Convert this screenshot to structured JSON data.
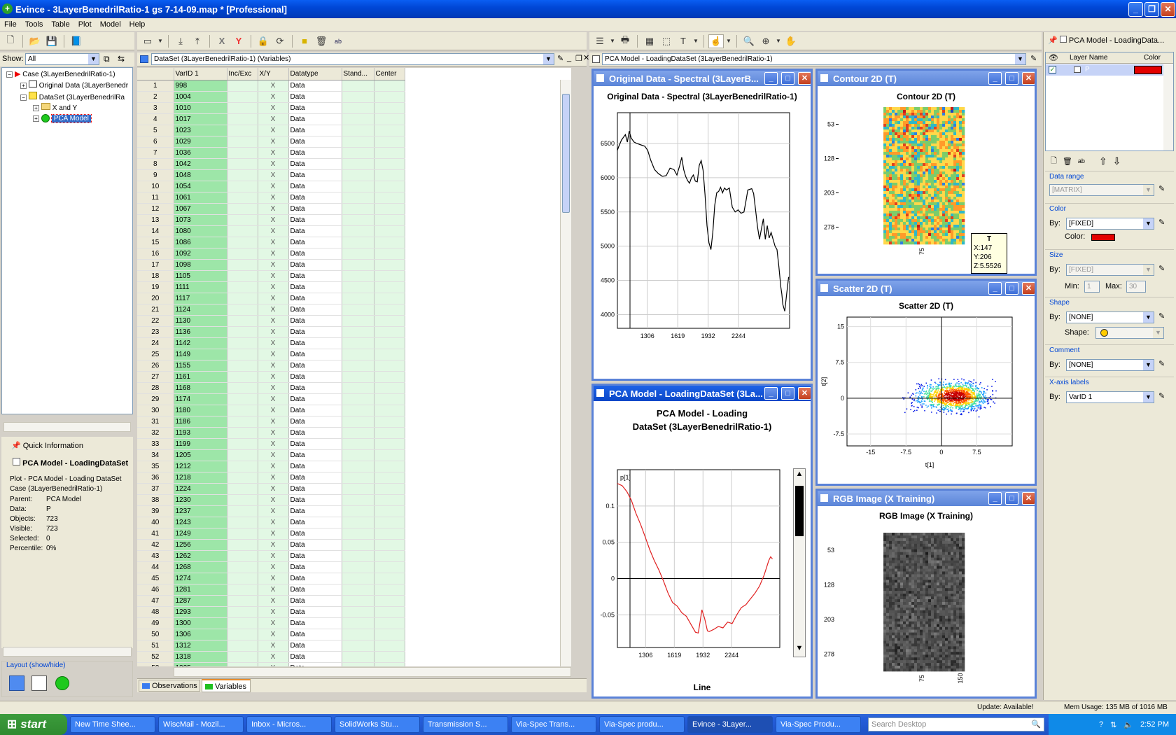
{
  "window": {
    "title": "Evince - 3LayerBenedrilRatio-1 gs 7-14-09.map * [Professional]"
  },
  "menu": [
    "File",
    "Tools",
    "Table",
    "Plot",
    "Model",
    "Help"
  ],
  "left": {
    "show_label": "Show:",
    "show_value": "All",
    "tree": [
      {
        "label": "Case (3LayerBenedrilRatio-1)",
        "icon": "red-triangle-icon"
      },
      {
        "label": "Original Data (3LayerBenedr",
        "icon": "table-icon"
      },
      {
        "label": "DataSet (3LayerBenedrilRa",
        "icon": "yellow-square-icon"
      },
      {
        "label": "X and Y",
        "icon": "folder-icon"
      },
      {
        "label": "PCA Model",
        "icon": "green-circle-icon"
      }
    ],
    "quick_info": {
      "title": "Quick Information",
      "name": "PCA Model - LoadingDataSet",
      "desc1": "Plot - PCA Model - Loading DataSet",
      "desc2": "Case (3LayerBenedrilRatio-1)",
      "rows": [
        [
          "Parent:",
          "PCA Model"
        ],
        [
          "Data:",
          "P"
        ],
        [
          "Objects:",
          "723"
        ],
        [
          "Visible:",
          "723"
        ],
        [
          "Selected:",
          "0"
        ],
        [
          "Percentile:",
          "0%"
        ]
      ]
    },
    "layout_label": "Layout (show/hide)"
  },
  "dataset": {
    "title": "DataSet (3LayerBenedrilRatio-1) (Variables)",
    "columns": [
      "VarID 1",
      "Inc/Exc",
      "X/Y",
      "Datatype",
      "Stand...",
      "Center"
    ],
    "x_mark": "X",
    "datatype": "Data",
    "rows": [
      "998",
      "1004",
      "1010",
      "1017",
      "1023",
      "1029",
      "1036",
      "1042",
      "1048",
      "1054",
      "1061",
      "1067",
      "1073",
      "1080",
      "1086",
      "1092",
      "1098",
      "1105",
      "1111",
      "1117",
      "1124",
      "1130",
      "1136",
      "1142",
      "1149",
      "1155",
      "1161",
      "1168",
      "1174",
      "1180",
      "1186",
      "1193",
      "1199",
      "1205",
      "1212",
      "1218",
      "1224",
      "1230",
      "1237",
      "1243",
      "1249",
      "1256",
      "1262",
      "1268",
      "1274",
      "1281",
      "1287",
      "1293",
      "1300",
      "1306",
      "1312",
      "1318",
      "1325"
    ],
    "tabs": [
      "Observations",
      "Variables"
    ]
  },
  "plot_combo": "PCA Model - LoadingDataSet (3LayerBenedrilRatio-1)",
  "windows": {
    "orig": {
      "caption": "Original Data - Spectral (3LayerB...",
      "title": "Original Data - Spectral (3LayerBenedrilRatio-1)"
    },
    "contour": {
      "caption": "Contour 2D (T)",
      "title": "Contour 2D (T)",
      "yticks": [
        "53",
        "128",
        "203",
        "278"
      ],
      "xtick": "75",
      "tooltip": [
        "T",
        "X:147",
        "Y:206",
        "Z:5.5526"
      ]
    },
    "loading": {
      "caption": "PCA Model - LoadingDataSet (3La...",
      "title1": "PCA Model - Loading",
      "title2": "DataSet (3LayerBenedrilRatio-1)",
      "footer": "Line",
      "series": "p[1]"
    },
    "scatter": {
      "caption": "Scatter 2D (T)",
      "title": "Scatter 2D (T)",
      "xlabel": "t[1]",
      "ylabel": "t[2]"
    },
    "rgb": {
      "caption": "RGB Image (X Training)",
      "title": "RGB Image (X Training)",
      "yticks": [
        "53",
        "128",
        "203",
        "278"
      ],
      "xticks": [
        "75",
        "150"
      ]
    }
  },
  "chart_data": [
    {
      "type": "line",
      "title": "Original Data - Spectral (3LayerBenedrilRatio-1)",
      "xlabel": "",
      "ylabel": "",
      "xticks": [
        1306,
        1619,
        1932,
        2244
      ],
      "yticks": [
        4000,
        4500,
        5000,
        5500,
        6000,
        6500
      ],
      "xlim": [
        998,
        2770
      ],
      "ylim": [
        3800,
        6950
      ],
      "x": [
        998,
        1010,
        1040,
        1080,
        1100,
        1120,
        1140,
        1170,
        1200,
        1240,
        1280,
        1310,
        1340,
        1380,
        1420,
        1460,
        1500,
        1540,
        1580,
        1610,
        1640,
        1660,
        1680,
        1700,
        1720,
        1740,
        1760,
        1780,
        1800,
        1820,
        1840,
        1860,
        1880,
        1900,
        1920,
        1940,
        1960,
        1980,
        2000,
        2020,
        2040,
        2060,
        2080,
        2100,
        2120,
        2150,
        2180,
        2210,
        2240,
        2270,
        2300,
        2320,
        2340,
        2360,
        2380,
        2400,
        2420,
        2440,
        2460,
        2480,
        2500,
        2520,
        2540,
        2560,
        2580,
        2600,
        2620,
        2640,
        2660,
        2680,
        2690,
        2700,
        2720,
        2740,
        2760
      ],
      "y": [
        6400,
        6450,
        6550,
        6630,
        6520,
        6680,
        6580,
        6520,
        6500,
        6480,
        6460,
        6400,
        6260,
        6120,
        6060,
        6020,
        6030,
        6140,
        6120,
        6040,
        6180,
        6300,
        6120,
        6020,
        5960,
        5920,
        6000,
        6040,
        5950,
        5940,
        6180,
        6250,
        6110,
        5750,
        5300,
        5050,
        4950,
        5200,
        5600,
        5780,
        5800,
        5860,
        5780,
        5850,
        5820,
        5850,
        5570,
        5500,
        5530,
        5480,
        5500,
        5650,
        5820,
        5830,
        5840,
        5770,
        5530,
        5280,
        5100,
        5250,
        5400,
        5100,
        5300,
        5120,
        5200,
        5100,
        5000,
        4950,
        4700,
        4400,
        4300,
        4150,
        4050,
        4300,
        4550
      ]
    },
    {
      "type": "heatmap",
      "title": "Contour 2D (T)",
      "yticks": [
        53,
        128,
        203,
        278
      ],
      "xticks": [
        75
      ]
    },
    {
      "type": "line",
      "title": "PCA Model - Loading DataSet (3LayerBenedrilRatio-1)",
      "xlabel": "Line",
      "ylabel": "p[1]",
      "xticks": [
        1306,
        1619,
        1932,
        2244
      ],
      "yticks": [
        -0.05,
        0,
        0.05,
        0.1
      ],
      "xlim": [
        998,
        2770
      ],
      "ylim": [
        -0.095,
        0.15
      ],
      "x": [
        998,
        1050,
        1100,
        1150,
        1200,
        1250,
        1300,
        1350,
        1400,
        1450,
        1500,
        1550,
        1600,
        1650,
        1700,
        1750,
        1800,
        1850,
        1880,
        1900,
        1920,
        1950,
        1980,
        2000,
        2050,
        2100,
        2150,
        2200,
        2250,
        2300,
        2350,
        2400,
        2450,
        2500,
        2550,
        2600,
        2650,
        2670,
        2690
      ],
      "y": [
        0.131,
        0.128,
        0.12,
        0.108,
        0.09,
        0.075,
        0.058,
        0.04,
        0.025,
        0.012,
        -0.003,
        -0.02,
        -0.033,
        -0.038,
        -0.047,
        -0.052,
        -0.063,
        -0.074,
        -0.075,
        -0.06,
        -0.043,
        -0.055,
        -0.072,
        -0.073,
        -0.07,
        -0.066,
        -0.068,
        -0.06,
        -0.062,
        -0.05,
        -0.04,
        -0.036,
        -0.028,
        -0.02,
        -0.01,
        0.005,
        0.025,
        0.03,
        0.027
      ]
    },
    {
      "type": "scatter",
      "title": "Scatter 2D (T)",
      "xlabel": "t[1]",
      "ylabel": "t[2]",
      "xticks": [
        -15,
        -7.5,
        0,
        7.5
      ],
      "yticks": [
        -7.5,
        0,
        7.5,
        15
      ],
      "xlim": [
        -20,
        15
      ],
      "ylim": [
        -10,
        17
      ],
      "cluster_center": [
        3,
        0.5
      ],
      "cluster_spread": [
        6,
        3.5
      ]
    },
    {
      "type": "heatmap",
      "title": "RGB Image (X Training)",
      "yticks": [
        53,
        128,
        203,
        278
      ],
      "xticks": [
        75,
        150
      ]
    }
  ],
  "right": {
    "title": "PCA Model - LoadingData...",
    "layer_col": "Layer Name",
    "color_col": "Color",
    "layer": "P",
    "layer_color": "#e30000",
    "data_range_title": "Data range",
    "data_range": "[MATRIX]",
    "color_title": "Color",
    "by": "By:",
    "color_by": "[FIXED]",
    "color_label": "Color:",
    "size_title": "Size",
    "size_by": "[FIXED]",
    "min_label": "Min:",
    "min": "1",
    "max_label": "Max:",
    "max": "30",
    "shape_title": "Shape",
    "shape_by": "[NONE]",
    "shape_label": "Shape:",
    "comment_title": "Comment",
    "comment_by": "[NONE]",
    "xaxis_title": "X-axis labels",
    "xaxis_by": "VarID 1"
  },
  "status": {
    "update": "Update: Available!",
    "mem": "Mem Usage: 135 MB of 1016 MB"
  },
  "taskbar": {
    "start": "start",
    "tasks": [
      "New Time Shee...",
      "WiscMail - Mozil...",
      "Inbox - Micros...",
      "SolidWorks Stu...",
      "Transmission S...",
      "Via-Spec Trans...",
      "Via-Spec produ...",
      "Evince - 3Layer...",
      "Via-Spec Produ..."
    ],
    "search": "Search Desktop",
    "clock": "2:52 PM"
  }
}
